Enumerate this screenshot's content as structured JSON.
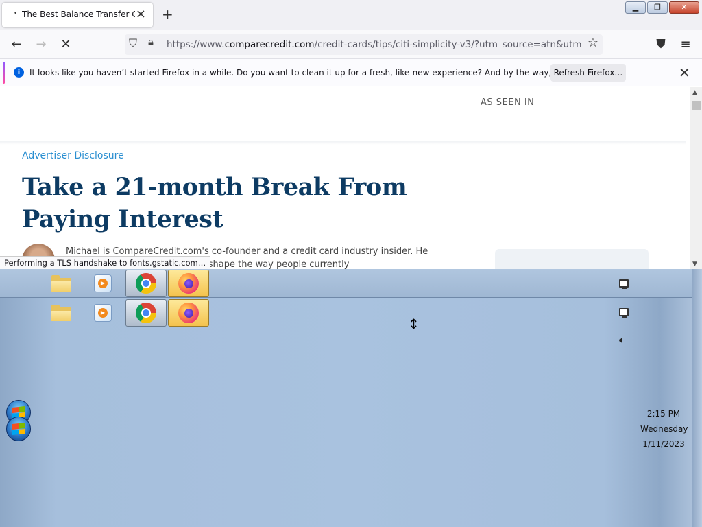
{
  "browser": {
    "tab": {
      "title": "The Best Balance Transfer Card",
      "loading_dot": "•"
    },
    "url": {
      "prefix": "https://www.",
      "domain": "comparecredit.com",
      "path": "/credit-cards/tips/citi-simplicity-v3/?utm_source=atn&utm_campaig"
    },
    "notification": {
      "text": "It looks like you haven’t started Firefox in a while. Do you want to clean it up for a fresh, like-new experience? And by the way, welcome back!",
      "button": "Refresh Firefox…"
    },
    "status": "Performing a TLS handshake to fonts.gstatic.com…"
  },
  "page": {
    "as_seen_in": "AS SEEN IN",
    "advertiser_disclosure": "Advertiser Disclosure",
    "headline": "Take a 21-month Break From Paying Interest",
    "author_bio": "Michael is CompareCredit.com's co-founder and a credit card industry insider. He spent … U.S. banks and helped shape the way people currently"
  },
  "taskbar": {
    "pinned": [
      "folder-icon",
      "media-player-icon",
      "chrome-icon",
      "firefox-icon"
    ],
    "clock": {
      "time": "2:15 PM",
      "day": "Wednesday",
      "date": "1/11/2023"
    }
  },
  "colors": {
    "headline": "#0d3b63",
    "link": "#2b8fd1",
    "taskbar": "#a9c2df"
  }
}
